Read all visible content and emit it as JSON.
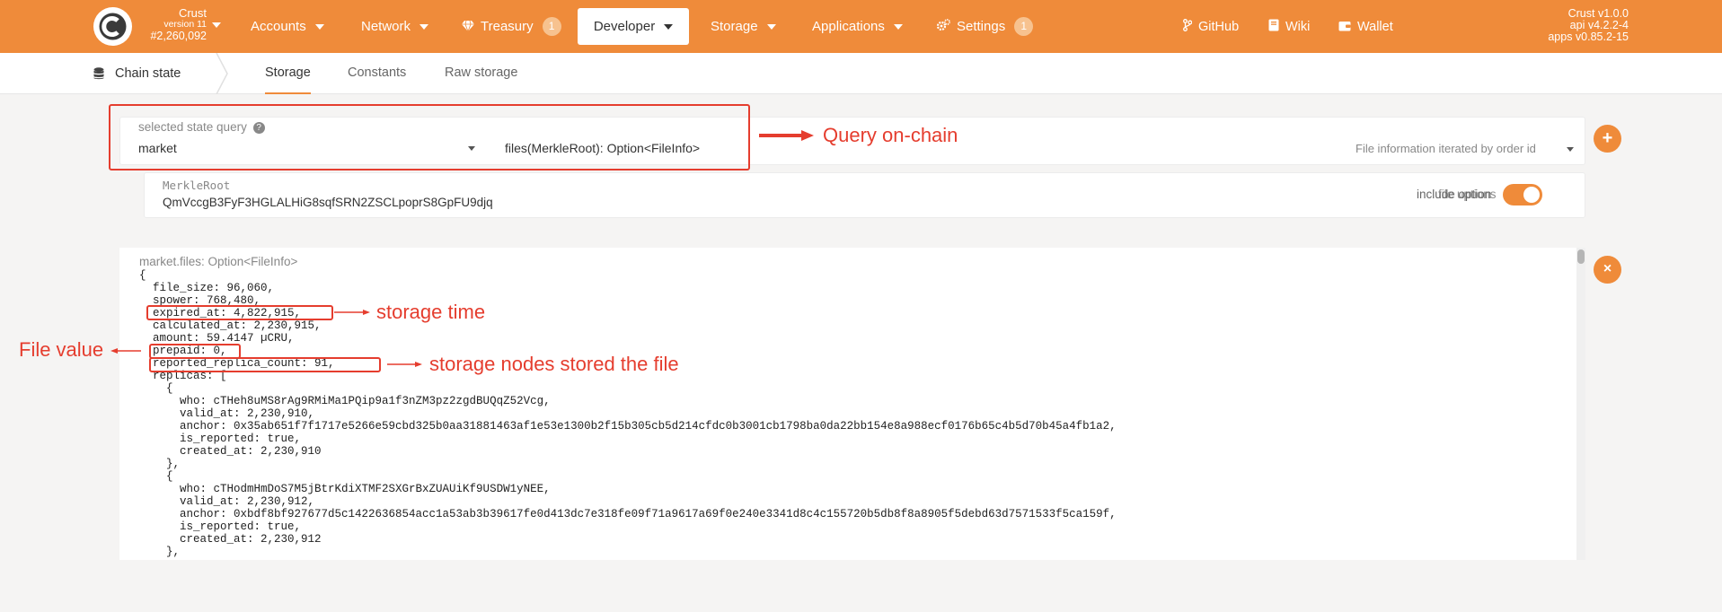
{
  "header": {
    "chain_name": "Crust",
    "chain_version": "version 11",
    "block_number": "#2,260,092",
    "nav": {
      "accounts": "Accounts",
      "network": "Network",
      "treasury": "Treasury",
      "treasury_badge": "1",
      "developer": "Developer",
      "storage": "Storage",
      "applications": "Applications",
      "settings": "Settings",
      "settings_badge": "1",
      "github": "GitHub",
      "wiki": "Wiki",
      "wallet": "Wallet"
    },
    "versions": [
      "Crust v1.0.0",
      "api v4.2.2-4",
      "apps v0.85.2-15"
    ]
  },
  "subnav": {
    "title": "Chain state",
    "tabs": [
      {
        "label": "Storage",
        "active": true
      },
      {
        "label": "Constants",
        "active": false
      },
      {
        "label": "Raw storage",
        "active": false
      }
    ]
  },
  "query": {
    "label": "selected state query",
    "module": "market",
    "method": "files(MerkleRoot): Option<FileInfo>",
    "method_doc": "File information iterated by order id",
    "param_label": "MerkleRoot",
    "param_value": "QmVccgB3FyF3HGLALHiG8sqfSRN2ZSCLpoprS8GpFU9djq",
    "toggle_label": "include option",
    "toggle_overlap_label": "file uptions",
    "toggle_on": true
  },
  "result": {
    "label": "market.files: Option<FileInfo>",
    "lines": [
      "{",
      "  file_size: 96,060,",
      "  spower: 768,480,",
      "  expired_at: 4,822,915,",
      "  calculated_at: 2,230,915,",
      "  amount: 59.4147 µCRU,",
      "  prepaid: 0,",
      "  reported_replica_count: 91,",
      "  replicas: [",
      "    {",
      "      who: cTHeh8uMS8rAg9RMiMa1PQip9a1f3nZM3pz2zgdBUQqZ52Vcg,",
      "      valid_at: 2,230,910,",
      "      anchor: 0x35ab651f7f1717e5266e59cbd325b0aa31881463af1e53e1300b2f15b305cb5d214cfdc0b3001cb1798ba0da22bb154e8a988ecf0176b65c4b5d70b45a4fb1a2,",
      "      is_reported: true,",
      "      created_at: 2,230,910",
      "    },",
      "    {",
      "      who: cTHodmHmDoS7M5jBtrKdiXTMF2SXGrBxZUAUiKf9USDW1yNEE,",
      "      valid_at: 2,230,912,",
      "      anchor: 0xbdf8bf927677d5c1422636854acc1a53ab3b39617fe0d413dc7e318fe09f71a9617a69f0e240e3341d8c4c155720b5db8f8a8905f5debd63d7571533f5ca159f,",
      "      is_reported: true,",
      "      created_at: 2,230,912",
      "    },"
    ]
  },
  "annotations": {
    "query_on_chain": "Query on-chain",
    "storage_time": "storage time",
    "file_value": "File value",
    "storage_nodes": "storage nodes stored the file"
  },
  "colors": {
    "accent": "#ef8b3a",
    "annotation": "#e53d2e"
  },
  "icons": {
    "logo": "crust-logo-icon",
    "treasury": "gem-icon",
    "settings": "gears-icon",
    "github": "code-branch-icon",
    "wiki": "book-icon",
    "wallet": "wallet-icon",
    "chain_state": "database-icon",
    "add": "plus-icon",
    "remove": "close-icon"
  }
}
